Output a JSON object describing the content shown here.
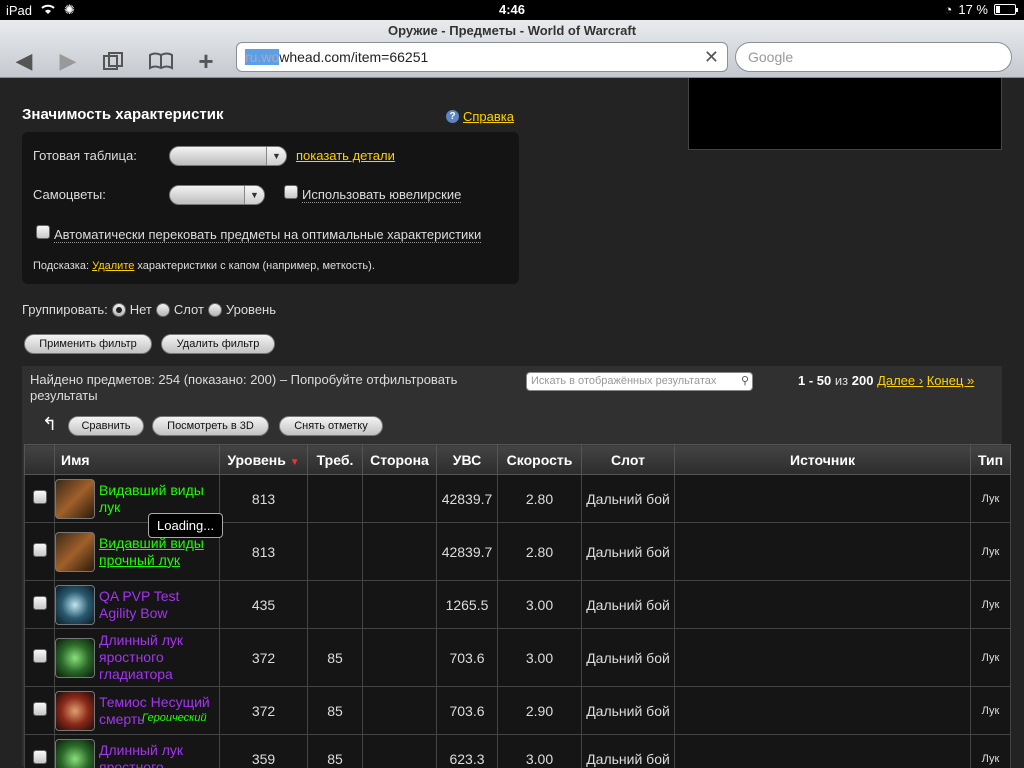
{
  "status": {
    "device": "iPad",
    "time": "4:46",
    "battery": "17 %"
  },
  "browser": {
    "title": "Оружие - Предметы - World of Warcraft",
    "url_selected": "ru.wo",
    "url_rest": "whead.com/item=66251",
    "search_placeholder": "Google"
  },
  "stat_weights": {
    "title": "Значимость характеристик",
    "help": "Справка",
    "preset_label": "Готовая таблица:",
    "show_details": "показать детали",
    "gems_label": "Самоцветы:",
    "use_jc": "Использовать ювелирские",
    "auto_reforge": "Автоматически перековать предметы на оптимальные характеристики",
    "hint_prefix": "Подсказка:",
    "hint_link": "Удалите",
    "hint_suffix": "характеристики с капом (например, меткость)."
  },
  "grouping": {
    "label": "Группировать:",
    "options": [
      "Нет",
      "Слот",
      "Уровень"
    ],
    "selected": "Нет"
  },
  "filter_buttons": {
    "apply": "Применить фильтр",
    "remove": "Удалить фильтр"
  },
  "results": {
    "found_text": "Найдено предметов: 254 (показано: 200) – Попробуйте отфильтровать результаты",
    "search_placeholder": "Искать в отображённых результатах",
    "range": "1 - 50",
    "of": "из",
    "total": "200",
    "next": "Далее ›",
    "last": "Конец »",
    "compare": "Сравнить",
    "view3d": "Посмотреть в 3D",
    "uncheck": "Снять отметку"
  },
  "table": {
    "headers": {
      "name": "Имя",
      "level": "Уровень",
      "req": "Треб.",
      "side": "Сторона",
      "dps": "УВС",
      "speed": "Скорость",
      "slot": "Слот",
      "source": "Источник",
      "type": "Тип"
    },
    "rows": [
      {
        "name": "Видавший виды лук",
        "level": "813",
        "req": "",
        "dps": "42839.7",
        "speed": "2.80",
        "slot": "Дальний бой",
        "type": "Лук"
      },
      {
        "name": "Видавший виды прочный лук",
        "level": "813",
        "req": "",
        "dps": "42839.7",
        "speed": "2.80",
        "slot": "Дальний бой",
        "type": "Лук"
      },
      {
        "name": "QA PVP Test Agility Bow",
        "level": "435",
        "req": "",
        "dps": "1265.5",
        "speed": "3.00",
        "slot": "Дальний бой",
        "type": "Лук"
      },
      {
        "name": "Длинный лук яростного гладиатора",
        "level": "372",
        "req": "85",
        "dps": "703.6",
        "speed": "3.00",
        "slot": "Дальний бой",
        "type": "Лук"
      },
      {
        "name": "Темиос Несущий смерть",
        "level": "372",
        "req": "85",
        "dps": "703.6",
        "speed": "2.90",
        "slot": "Дальний бой",
        "type": "Лук"
      },
      {
        "name": "Длинный лук яростного",
        "level": "359",
        "req": "85",
        "dps": "623.3",
        "speed": "3.00",
        "slot": "Дальний бой",
        "type": "Лук"
      }
    ]
  },
  "tooltip": "Loading...",
  "heroic_tag": "Героический",
  "colors": {
    "uncommon": "#1eff00",
    "epic": "#a335ee",
    "link": "#ffd100"
  }
}
